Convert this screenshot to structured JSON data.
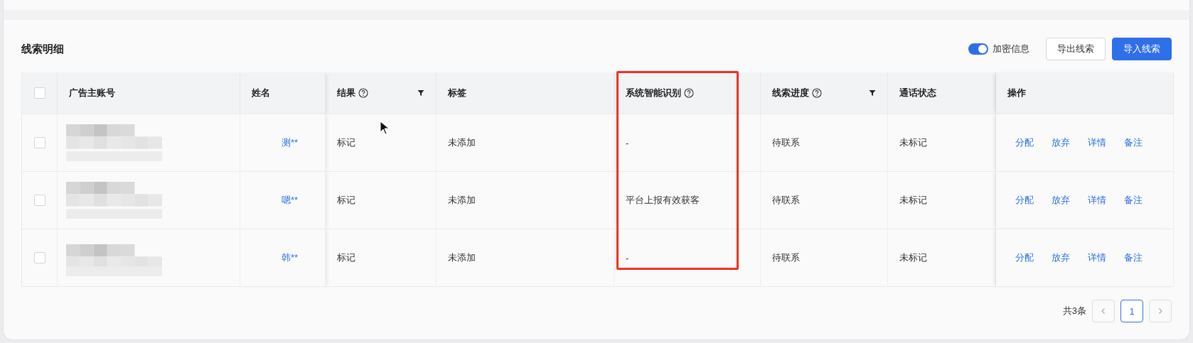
{
  "title": "线索明细",
  "encrypt_toggle": {
    "label": "加密信息",
    "on": true
  },
  "buttons": [
    {
      "label": "导出线索",
      "kind": "default"
    },
    {
      "label": "导入线索",
      "kind": "primary"
    }
  ],
  "table": {
    "select_all": {
      "checked": false
    },
    "columns": [
      {
        "label": "广告主账号",
        "help": false,
        "filter": false
      },
      {
        "label": "姓名",
        "help": false,
        "filter": false
      },
      {
        "label": "结果",
        "help": true,
        "filter": true
      },
      {
        "label": "标签",
        "help": false,
        "filter": false
      },
      {
        "label": "系统智能识别",
        "help": true,
        "filter": false
      },
      {
        "label": "线索进度",
        "help": true,
        "filter": true
      },
      {
        "label": "通话状态",
        "help": false,
        "filter": false
      },
      {
        "label": "操作",
        "help": false,
        "filter": false
      }
    ],
    "rows": [
      {
        "checked": false,
        "account_redacted": true,
        "name": "测**",
        "result": "标记",
        "tag": "未添加",
        "ai": "-",
        "progress": "待联系",
        "call": "未标记",
        "actions": [
          "分配",
          "放弃",
          "详情",
          "备注"
        ]
      },
      {
        "checked": false,
        "account_redacted": true,
        "name": "嗯**",
        "result": "标记",
        "tag": "未添加",
        "ai": "平台上报有效获客",
        "progress": "待联系",
        "call": "未标记",
        "actions": [
          "分配",
          "放弃",
          "详情",
          "备注"
        ]
      },
      {
        "checked": false,
        "account_redacted": true,
        "name": "韩**",
        "result": "标记",
        "tag": "未添加",
        "ai": "-",
        "progress": "待联系",
        "call": "未标记",
        "actions": [
          "分配",
          "放弃",
          "详情",
          "备注"
        ]
      }
    ]
  },
  "highlight_column": {
    "on": true
  },
  "pagination": {
    "total": "共3条",
    "pages": [
      {
        "label": "1",
        "selected": true
      }
    ]
  }
}
